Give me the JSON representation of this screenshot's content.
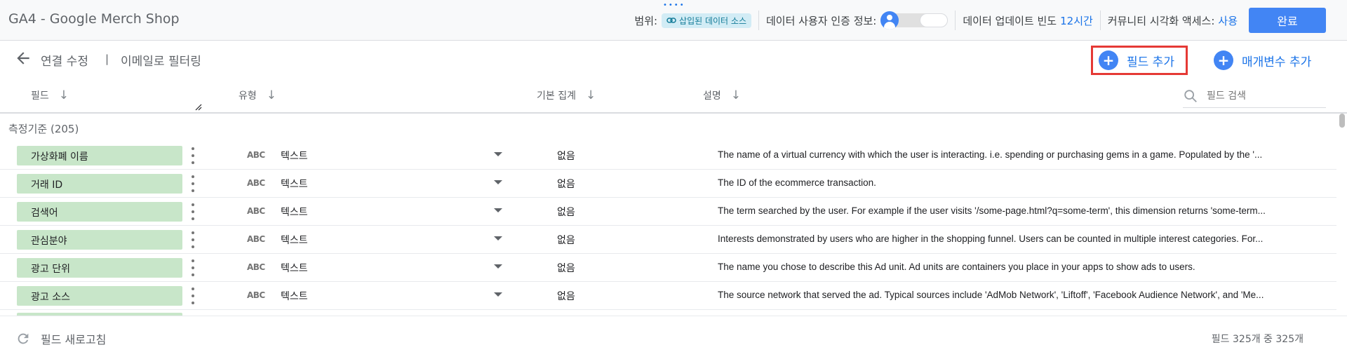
{
  "app": {
    "title": "GA4 - Google Merch Shop"
  },
  "topbar": {
    "scope_label": "범위:",
    "scope_chip": "삽입된 데이터 소스",
    "credentials_label": "데이터 사용자 인증 정보:",
    "freshness_label": "데이터 업데이트 빈도",
    "freshness_value": "12시간",
    "community_label": "커뮤니티 시각화 액세스:",
    "community_value": "사용",
    "done_button": "완료"
  },
  "subbar": {
    "crumb_edit_connection": "연결 수정",
    "crumb_separator": "|",
    "crumb_filter_email": "이메일로 필터링",
    "add_field": "필드 추가",
    "add_parameter": "매개변수 추가"
  },
  "columns": {
    "field": "필드",
    "type": "유형",
    "aggregation": "기본 집계",
    "description": "설명",
    "search_placeholder": "필드 검색"
  },
  "group": {
    "label": "측정기준 (205)"
  },
  "rows": [
    {
      "name": "가상화폐 이름",
      "type_icon": "ABC",
      "type": "텍스트",
      "aggregation": "없음",
      "description": "The name of a virtual currency with which the user is interacting. i.e. spending or purchasing gems in a game. Populated by the '..."
    },
    {
      "name": "거래 ID",
      "type_icon": "ABC",
      "type": "텍스트",
      "aggregation": "없음",
      "description": "The ID of the ecommerce transaction."
    },
    {
      "name": "검색어",
      "type_icon": "ABC",
      "type": "텍스트",
      "aggregation": "없음",
      "description": "The term searched by the user. For example if the user visits '/some-page.html?q=some-term', this dimension returns 'some-term..."
    },
    {
      "name": "관심분야",
      "type_icon": "ABC",
      "type": "텍스트",
      "aggregation": "없음",
      "description": "Interests demonstrated by users who are higher in the shopping funnel. Users can be counted in multiple interest categories. For..."
    },
    {
      "name": "광고 단위",
      "type_icon": "ABC",
      "type": "텍스트",
      "aggregation": "없음",
      "description": "The name you chose to describe this Ad unit. Ad units are containers you place in your apps to show ads to users."
    },
    {
      "name": "광고 소스",
      "type_icon": "ABC",
      "type": "텍스트",
      "aggregation": "없음",
      "description": "The source network that served the ad. Typical sources include 'AdMob Network', 'Liftoff', 'Facebook Audience Network', and 'Me..."
    }
  ],
  "footer": {
    "refresh_label": "필드 새로고침",
    "count_text": "필드 325개 중 325개"
  },
  "colors": {
    "accent": "#1a73e8",
    "chip_green": "#c8e6c9",
    "highlight_red": "#e53935"
  }
}
